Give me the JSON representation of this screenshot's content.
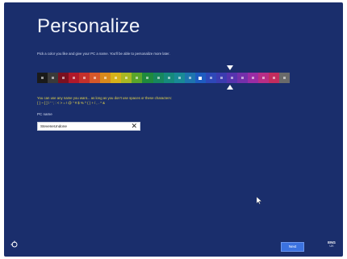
{
  "page": {
    "title": "Personalize",
    "intro": "Pick a color you like and give your PC a name. You'll be able to personalize more later."
  },
  "palette": {
    "selected_index": 15,
    "colors": [
      "#1a1a1a",
      "#3a3a3a",
      "#7a1020",
      "#b0182a",
      "#c4302b",
      "#d6582a",
      "#d98a1c",
      "#d6b21a",
      "#a8b823",
      "#5aa52b",
      "#1f8a3d",
      "#17875e",
      "#168a7c",
      "#198a96",
      "#1e75ae",
      "#1e5cc0",
      "#2e48b8",
      "#3c3cb0",
      "#5634ae",
      "#7430aa",
      "#9a2ca4",
      "#b82d86",
      "#c22c5e",
      "#6a6a6a"
    ]
  },
  "hint": {
    "line1": "You can use any name you want... as long as you don't use spaces or these characters:",
    "line2": "{ } ~ [ ] \\ ' ' ; : < > = ! @ \" # $ % ^ ( ) + / , . * &"
  },
  "pc_name": {
    "label": "PC name",
    "value": "SteveneUndone",
    "clear_glyph": "✕"
  },
  "footer": {
    "next_label": "Next",
    "lang_code": "ENG",
    "lang_region": "UK"
  }
}
